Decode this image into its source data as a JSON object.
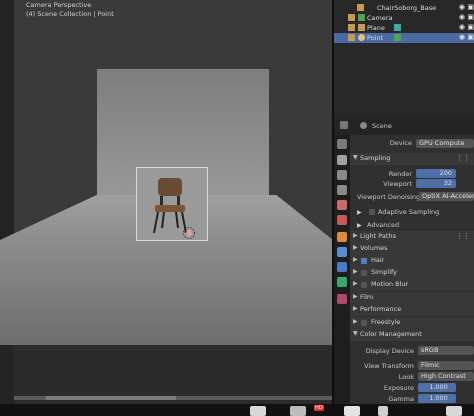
{
  "viewport": {
    "line1": "Camera Perspective",
    "line2": "(4) Scene Collection | Point"
  },
  "outliner": {
    "rows": [
      {
        "label": "ChairSoborg_Base"
      },
      {
        "label": "Camera"
      },
      {
        "label": "Plane"
      },
      {
        "label": "Point"
      }
    ]
  },
  "properties": {
    "scene_label": "Scene",
    "device_label": "Device",
    "device_value": "GPU Compute",
    "sampling": "Sampling",
    "render_label": "Render",
    "render_value": "200",
    "viewport_label": "Viewport",
    "viewport_value": "32",
    "denoise_label": "Viewport Denoising",
    "denoise_value": "OptiX AI-Accelerat...",
    "adaptive": "Adaptive Sampling",
    "advanced": "Advanced",
    "light_paths": "Light Paths",
    "volumes": "Volumes",
    "hair": "Hair",
    "simplify": "Simplify",
    "motion_blur": "Motion Blur",
    "film": "Film",
    "performance": "Performance",
    "freestyle": "Freestyle",
    "color_mgmt": "Color Management",
    "display_device_label": "Display Device",
    "display_device_value": "sRGB",
    "view_transform_label": "View Transform",
    "view_transform_value": "Filmic",
    "look_label": "Look",
    "look_value": "High Contrast",
    "exposure_label": "Exposure",
    "exposure_value": "1.000",
    "gamma_label": "Gamma",
    "gamma_value": "1.000"
  },
  "taskbar": {
    "badge": "HD"
  },
  "colors": {
    "selection": "#4a6aa1",
    "accent_blue": "#4f7fc3"
  }
}
